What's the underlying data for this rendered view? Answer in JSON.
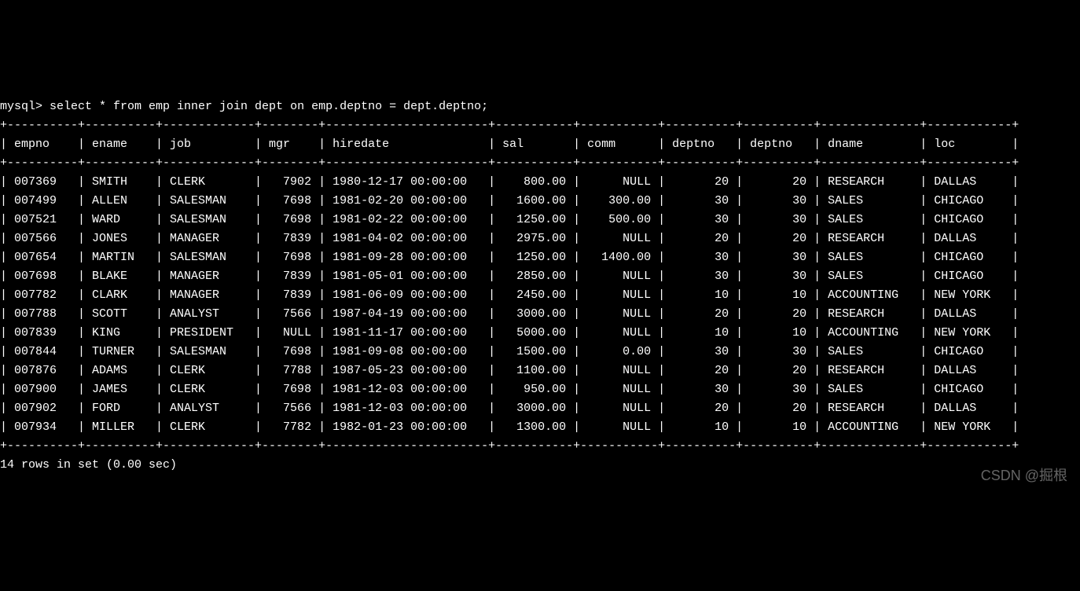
{
  "prompt": "mysql> ",
  "query": "select * from emp inner join dept on emp.deptno = dept.deptno;",
  "columns": [
    "empno",
    "ename",
    "job",
    "mgr",
    "hiredate",
    "sal",
    "comm",
    "deptno",
    "deptno",
    "dname",
    "loc"
  ],
  "widths": [
    8,
    8,
    11,
    6,
    21,
    9,
    9,
    8,
    8,
    12,
    10
  ],
  "align": [
    "l",
    "l",
    "l",
    "r",
    "l",
    "r",
    "r",
    "r",
    "r",
    "l",
    "l"
  ],
  "rows": [
    [
      "007369",
      "SMITH",
      "CLERK",
      "7902",
      "1980-12-17 00:00:00",
      "800.00",
      "NULL",
      "20",
      "20",
      "RESEARCH",
      "DALLAS"
    ],
    [
      "007499",
      "ALLEN",
      "SALESMAN",
      "7698",
      "1981-02-20 00:00:00",
      "1600.00",
      "300.00",
      "30",
      "30",
      "SALES",
      "CHICAGO"
    ],
    [
      "007521",
      "WARD",
      "SALESMAN",
      "7698",
      "1981-02-22 00:00:00",
      "1250.00",
      "500.00",
      "30",
      "30",
      "SALES",
      "CHICAGO"
    ],
    [
      "007566",
      "JONES",
      "MANAGER",
      "7839",
      "1981-04-02 00:00:00",
      "2975.00",
      "NULL",
      "20",
      "20",
      "RESEARCH",
      "DALLAS"
    ],
    [
      "007654",
      "MARTIN",
      "SALESMAN",
      "7698",
      "1981-09-28 00:00:00",
      "1250.00",
      "1400.00",
      "30",
      "30",
      "SALES",
      "CHICAGO"
    ],
    [
      "007698",
      "BLAKE",
      "MANAGER",
      "7839",
      "1981-05-01 00:00:00",
      "2850.00",
      "NULL",
      "30",
      "30",
      "SALES",
      "CHICAGO"
    ],
    [
      "007782",
      "CLARK",
      "MANAGER",
      "7839",
      "1981-06-09 00:00:00",
      "2450.00",
      "NULL",
      "10",
      "10",
      "ACCOUNTING",
      "NEW YORK"
    ],
    [
      "007788",
      "SCOTT",
      "ANALYST",
      "7566",
      "1987-04-19 00:00:00",
      "3000.00",
      "NULL",
      "20",
      "20",
      "RESEARCH",
      "DALLAS"
    ],
    [
      "007839",
      "KING",
      "PRESIDENT",
      "NULL",
      "1981-11-17 00:00:00",
      "5000.00",
      "NULL",
      "10",
      "10",
      "ACCOUNTING",
      "NEW YORK"
    ],
    [
      "007844",
      "TURNER",
      "SALESMAN",
      "7698",
      "1981-09-08 00:00:00",
      "1500.00",
      "0.00",
      "30",
      "30",
      "SALES",
      "CHICAGO"
    ],
    [
      "007876",
      "ADAMS",
      "CLERK",
      "7788",
      "1987-05-23 00:00:00",
      "1100.00",
      "NULL",
      "20",
      "20",
      "RESEARCH",
      "DALLAS"
    ],
    [
      "007900",
      "JAMES",
      "CLERK",
      "7698",
      "1981-12-03 00:00:00",
      "950.00",
      "NULL",
      "30",
      "30",
      "SALES",
      "CHICAGO"
    ],
    [
      "007902",
      "FORD",
      "ANALYST",
      "7566",
      "1981-12-03 00:00:00",
      "3000.00",
      "NULL",
      "20",
      "20",
      "RESEARCH",
      "DALLAS"
    ],
    [
      "007934",
      "MILLER",
      "CLERK",
      "7782",
      "1982-01-23 00:00:00",
      "1300.00",
      "NULL",
      "10",
      "10",
      "ACCOUNTING",
      "NEW YORK"
    ]
  ],
  "footer": "14 rows in set (0.00 sec)",
  "watermark": "CSDN @掘根"
}
